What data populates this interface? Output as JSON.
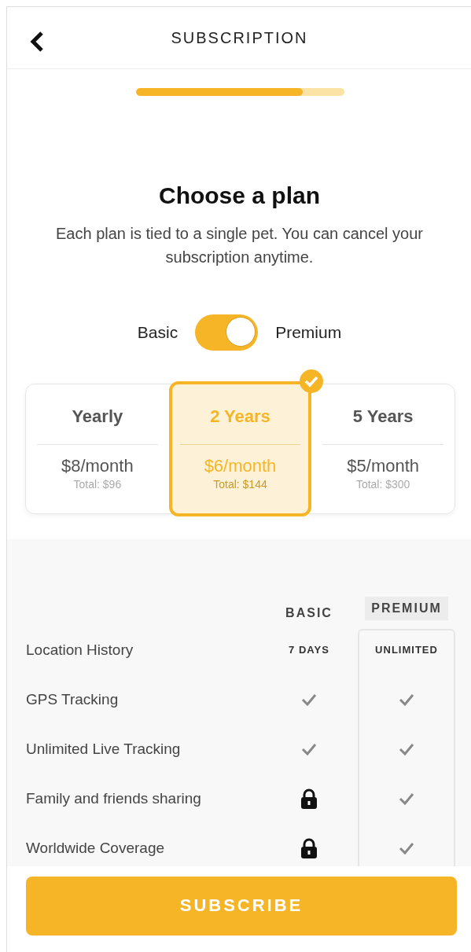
{
  "header": {
    "title": "SUBSCRIPTION"
  },
  "progress": {
    "level": 0.8
  },
  "intro": {
    "title": "Choose a plan",
    "subtitle": "Each plan is tied to a single pet. You can cancel your subscription anytime."
  },
  "tier_toggle": {
    "left_label": "Basic",
    "right_label": "Premium",
    "on": true
  },
  "plans": [
    {
      "name": "Yearly",
      "price": "$8/month",
      "total": "Total: $96",
      "selected": false
    },
    {
      "name": "2 Years",
      "price": "$6/month",
      "total": "Total: $144",
      "selected": true
    },
    {
      "name": "5 Years",
      "price": "$5/month",
      "total": "Total: $300",
      "selected": false
    }
  ],
  "comparison": {
    "columns": [
      "BASIC",
      "PREMIUM"
    ],
    "rows": [
      {
        "feature": "Location History",
        "cells": [
          {
            "kind": "text",
            "text": "7 DAYS"
          },
          {
            "kind": "text",
            "text": "UNLIMITED"
          }
        ]
      },
      {
        "feature": "GPS Tracking",
        "cells": [
          {
            "kind": "check"
          },
          {
            "kind": "check"
          }
        ]
      },
      {
        "feature": "Unlimited Live Tracking",
        "cells": [
          {
            "kind": "check"
          },
          {
            "kind": "check"
          }
        ]
      },
      {
        "feature": "Family and friends sharing",
        "cells": [
          {
            "kind": "lock"
          },
          {
            "kind": "check"
          }
        ]
      },
      {
        "feature": "Worldwide Coverage",
        "cells": [
          {
            "kind": "lock"
          },
          {
            "kind": "check"
          }
        ]
      }
    ]
  },
  "subscribe_button": "SUBSCRIBE"
}
